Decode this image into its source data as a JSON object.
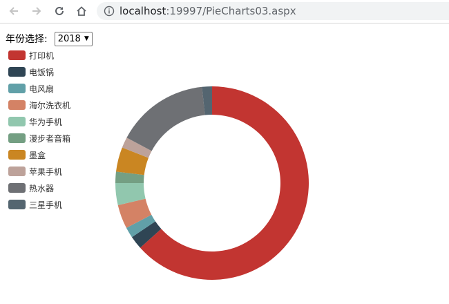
{
  "browser": {
    "url_host": "localhost",
    "url_rest": ":19997/PieCharts03.aspx"
  },
  "filter": {
    "label": "年份选择:",
    "selected": "2018"
  },
  "chart_data": {
    "type": "pie",
    "donut": true,
    "categories": [
      "打印机",
      "电饭锅",
      "电风扇",
      "海尔洗衣机",
      "华为手机",
      "漫步者音箱",
      "墨盒",
      "苹果手机",
      "热水器",
      "三星手机"
    ],
    "values": [
      570,
      20,
      16,
      36,
      33,
      17,
      37,
      16,
      140,
      15
    ],
    "colors": [
      "#c23531",
      "#2f4554",
      "#61a0a8",
      "#d48265",
      "#91c7ae",
      "#749f83",
      "#ca8622",
      "#bda29a",
      "#6e7074",
      "#546570"
    ],
    "legend_position": "left",
    "start_angle_deg": 90,
    "direction": "clockwise"
  }
}
